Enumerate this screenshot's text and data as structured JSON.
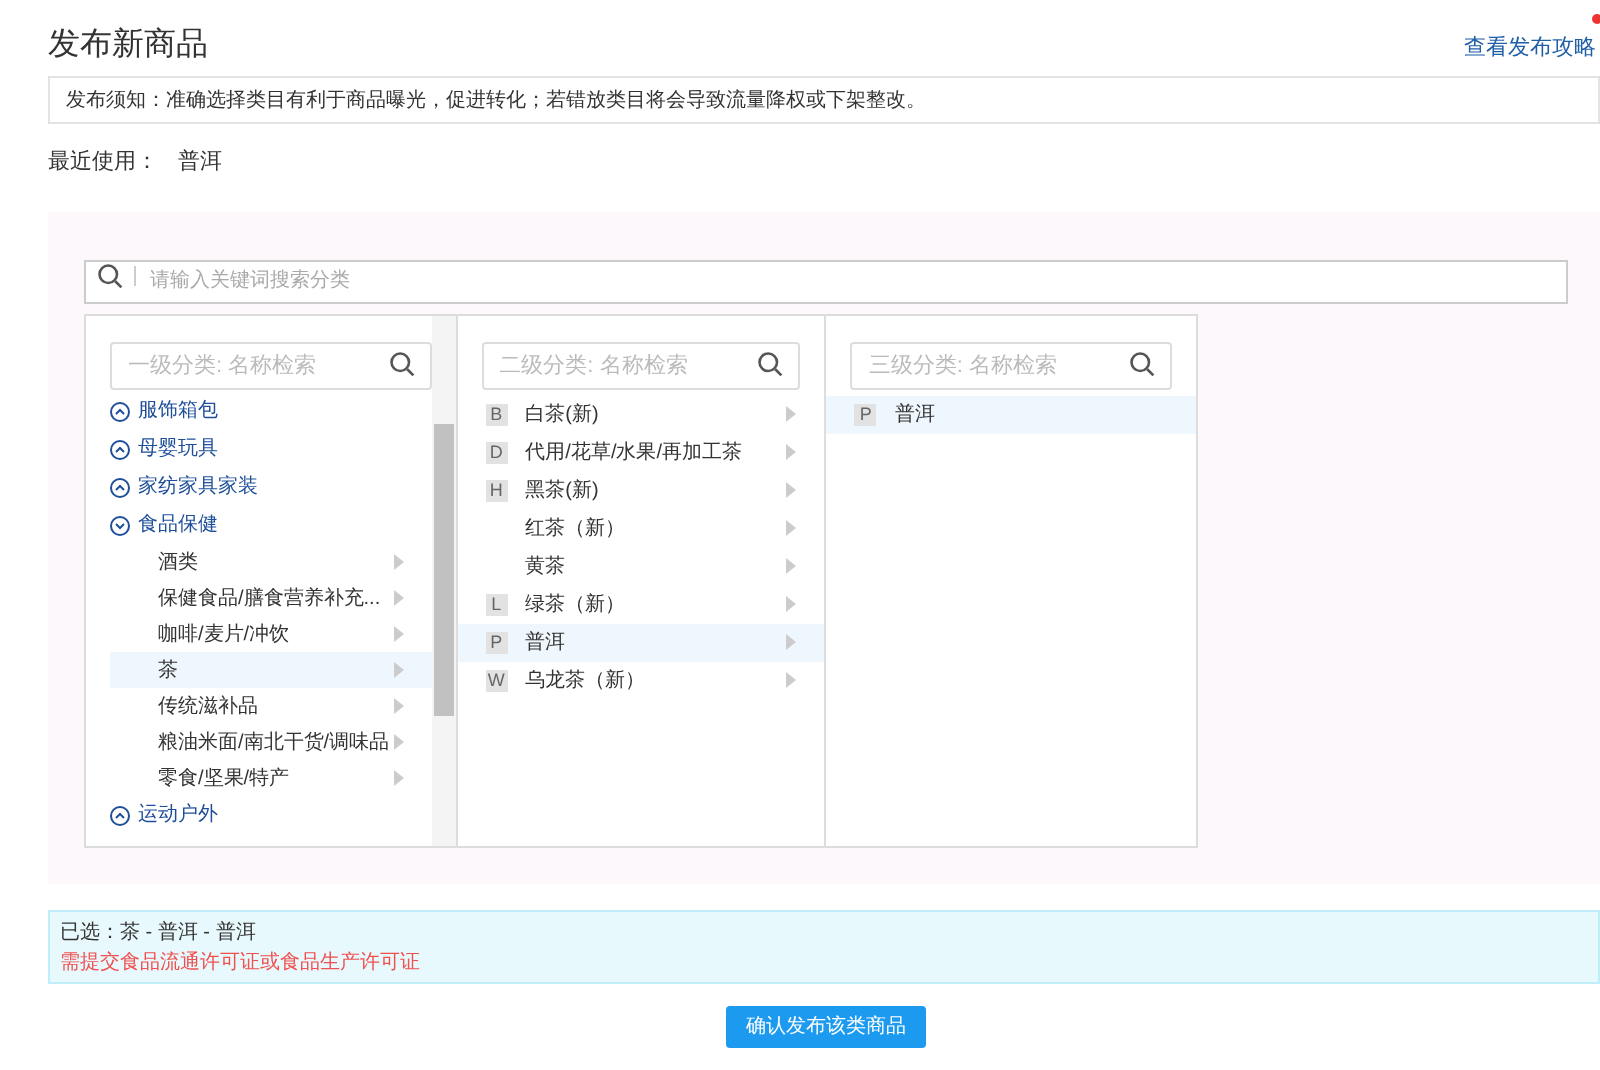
{
  "title": "发布新商品",
  "guide_link": {
    "label": "查看发布攻略",
    "badge_dot": true
  },
  "notice": "发布须知：准确选择类目有利于商品曝光，促进转化；若错放类目将会导致流量降权或下架整改。",
  "recent": {
    "label": "最近使用：",
    "items": [
      "普洱"
    ]
  },
  "search": {
    "placeholder": "请输入关键词搜索分类"
  },
  "level1": {
    "placeholder": "一级分类: 名称检索",
    "items": [
      {
        "label": "服饰箱包",
        "expanded": false
      },
      {
        "label": "母婴玩具",
        "expanded": false
      },
      {
        "label": "家纺家具家装",
        "expanded": false
      },
      {
        "label": "食品保健",
        "expanded": true,
        "children": [
          {
            "label": "酒类",
            "selected": false
          },
          {
            "label": "保健食品/膳食营养补充...",
            "selected": false
          },
          {
            "label": "咖啡/麦片/冲饮",
            "selected": false
          },
          {
            "label": "茶",
            "selected": true
          },
          {
            "label": "传统滋补品",
            "selected": false
          },
          {
            "label": "粮油米面/南北干货/调味品",
            "selected": false
          },
          {
            "label": "零食/坚果/特产",
            "selected": false
          }
        ]
      },
      {
        "label": "运动户外",
        "expanded": false
      }
    ]
  },
  "level2": {
    "placeholder": "二级分类: 名称检索",
    "items": [
      {
        "letter": "B",
        "label": "白茶(新)",
        "selected": false
      },
      {
        "letter": "D",
        "label": "代用/花草/水果/再加工茶",
        "selected": false
      },
      {
        "letter": "H",
        "label": "黑茶(新)",
        "selected": false
      },
      {
        "label": "红茶（新）",
        "selected": false
      },
      {
        "label": "黄茶",
        "selected": false
      },
      {
        "letter": "L",
        "label": "绿茶（新）",
        "selected": false
      },
      {
        "letter": "P",
        "label": "普洱",
        "selected": true
      },
      {
        "letter": "W",
        "label": "乌龙茶（新）",
        "selected": false
      }
    ]
  },
  "level3": {
    "placeholder": "三级分类: 名称检索",
    "items": [
      {
        "letter": "P",
        "label": "普洱",
        "selected": true
      }
    ]
  },
  "selection": {
    "path": "已选：茶 - 普洱 - 普洱",
    "warning": "需提交食品流通许可证或食品生产许可证"
  },
  "confirm_button": "确认发布该类商品"
}
